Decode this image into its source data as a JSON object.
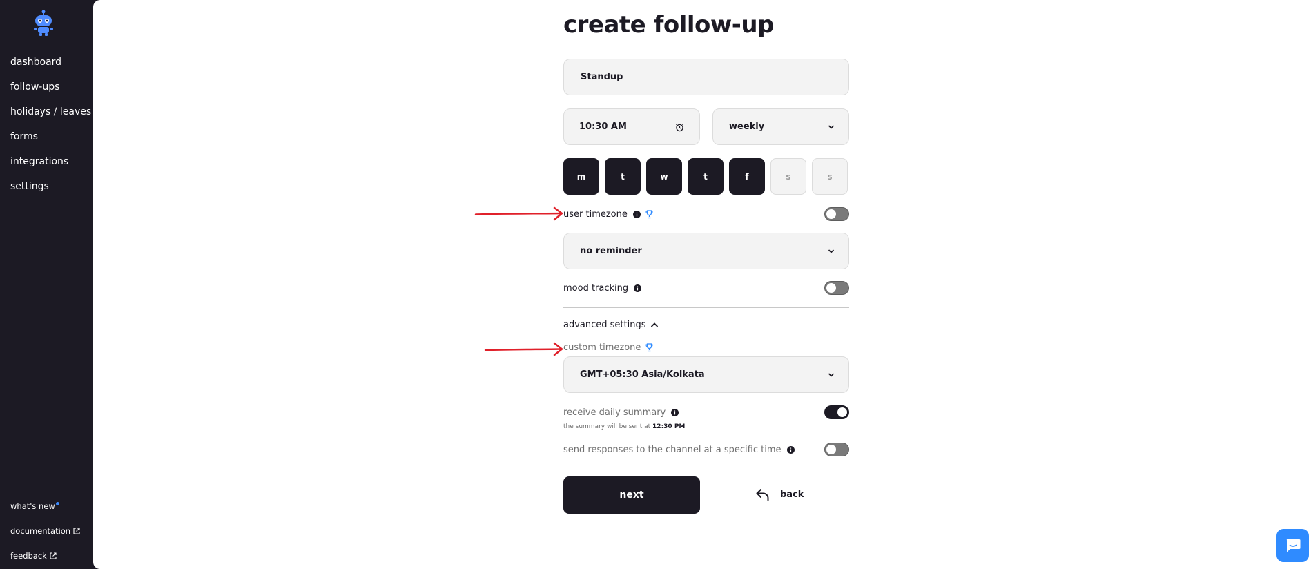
{
  "sidebar": {
    "logo_icon": "robot-icon",
    "items": [
      {
        "label": "dashboard"
      },
      {
        "label": "follow-ups"
      },
      {
        "label": "holidays / leaves"
      },
      {
        "label": "forms"
      },
      {
        "label": "integrations"
      },
      {
        "label": "settings"
      }
    ],
    "bottom_items": [
      {
        "label": "what's new",
        "badge": "new-dot"
      },
      {
        "label": "documentation",
        "icon": "external-link-icon"
      },
      {
        "label": "feedback",
        "icon": "external-link-icon"
      }
    ]
  },
  "page": {
    "title": "create follow-up"
  },
  "form": {
    "name_value": "Standup",
    "time_value": "10:30 AM",
    "time_icon": "alarm-clock-icon",
    "frequency_value": "weekly",
    "days": [
      {
        "label": "m",
        "selected": true
      },
      {
        "label": "t",
        "selected": true
      },
      {
        "label": "w",
        "selected": true
      },
      {
        "label": "t",
        "selected": true
      },
      {
        "label": "f",
        "selected": true
      },
      {
        "label": "s",
        "selected": false
      },
      {
        "label": "s",
        "selected": false
      }
    ],
    "user_timezone_label": "user timezone",
    "user_timezone_on": false,
    "reminder_value": "no reminder",
    "mood_tracking_label": "mood tracking",
    "mood_tracking_on": false,
    "advanced_settings_label": "advanced settings",
    "custom_timezone_label": "custom timezone",
    "timezone_value": "GMT+05:30 Asia/Kolkata",
    "daily_summary_label": "receive daily summary",
    "daily_summary_on": true,
    "summary_note_prefix": "the summary will be sent at",
    "summary_note_time": "12:30 PM",
    "send_responses_label": "send responses to the channel at a specific time",
    "send_responses_on": false,
    "next_label": "next",
    "back_label": "back"
  },
  "colors": {
    "sidebar_bg": "#1c1a24",
    "accent_blue": "#2f8bff",
    "annotation_red": "#e0202a"
  },
  "chat": {
    "icon": "chat-bubble-icon"
  }
}
